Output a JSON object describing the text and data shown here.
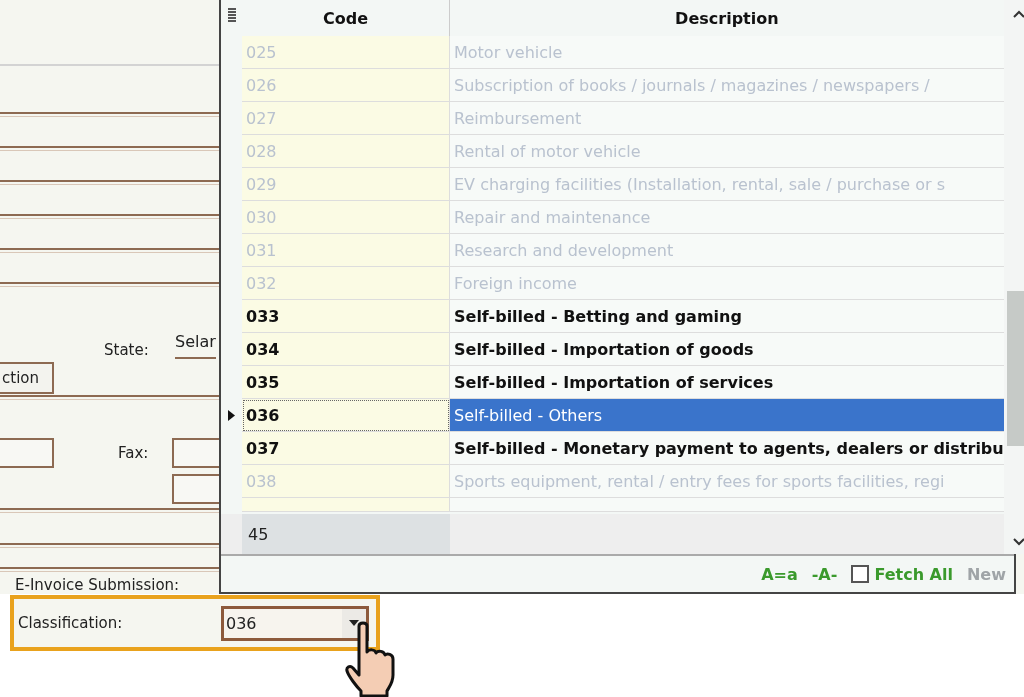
{
  "form": {
    "state_label": "State:",
    "state_value": "Selar",
    "section_button": "ction",
    "fax_label": "Fax:",
    "einvoice_label": "E-Invoice Submission:",
    "classification": {
      "label": "Classification:",
      "value": "036"
    }
  },
  "lookup": {
    "columns": [
      "Code",
      "Description"
    ],
    "rows": [
      {
        "code": "025",
        "description": "Motor vehicle",
        "disabled": true,
        "selected": false
      },
      {
        "code": "026",
        "description": "Subscription of books / journals / magazines / newspapers /",
        "disabled": true,
        "selected": false
      },
      {
        "code": "027",
        "description": "Reimbursement",
        "disabled": true,
        "selected": false
      },
      {
        "code": "028",
        "description": "Rental of motor vehicle",
        "disabled": true,
        "selected": false
      },
      {
        "code": "029",
        "description": "EV charging facilities (Installation, rental, sale / purchase or s",
        "disabled": true,
        "selected": false
      },
      {
        "code": "030",
        "description": "Repair and maintenance",
        "disabled": true,
        "selected": false
      },
      {
        "code": "031",
        "description": "Research and development",
        "disabled": true,
        "selected": false
      },
      {
        "code": "032",
        "description": "Foreign income",
        "disabled": true,
        "selected": false
      },
      {
        "code": "033",
        "description": "Self-billed - Betting and gaming",
        "disabled": false,
        "selected": false
      },
      {
        "code": "034",
        "description": "Self-billed - Importation of goods",
        "disabled": false,
        "selected": false
      },
      {
        "code": "035",
        "description": "Self-billed - Importation of services",
        "disabled": false,
        "selected": false
      },
      {
        "code": "036",
        "description": "Self-billed - Others",
        "disabled": false,
        "selected": true
      },
      {
        "code": "037",
        "description": "Self-billed - Monetary payment to agents, dealers or distribu",
        "disabled": false,
        "selected": false
      },
      {
        "code": "038",
        "description": "Sports equipment, rental / entry fees for sports facilities, regi",
        "disabled": true,
        "selected": false
      }
    ],
    "record_count": "45",
    "toolbar": {
      "case_toggle": "A=a",
      "match_toggle": "-A-",
      "fetch_all": {
        "label": "Fetch All",
        "checked": false
      },
      "new_button": {
        "label": "New",
        "disabled": true
      }
    }
  }
}
